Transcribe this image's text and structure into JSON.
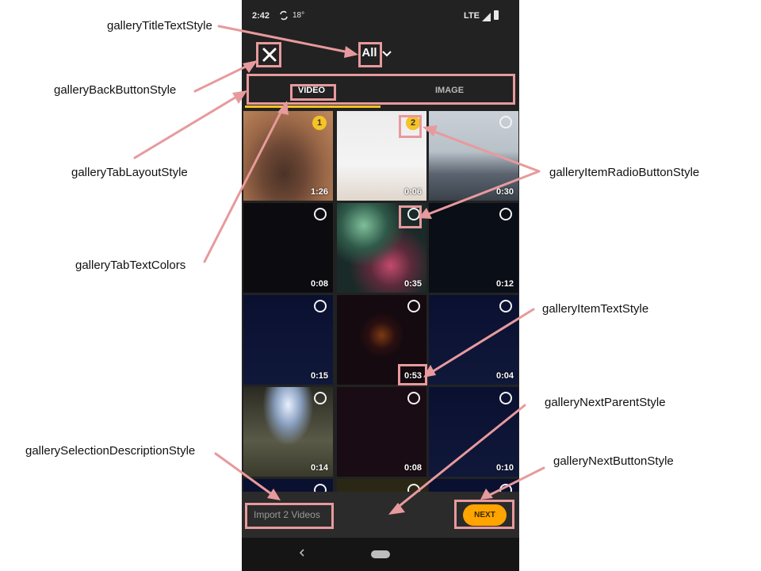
{
  "status_bar": {
    "time": "2:42",
    "temperature": "18°",
    "network": "LTE"
  },
  "header": {
    "title": "All",
    "back_icon": "close-icon",
    "dropdown_icon": "chevron-down-icon"
  },
  "tabs": [
    {
      "label": "VIDEO",
      "selected": true
    },
    {
      "label": "IMAGE",
      "selected": false
    }
  ],
  "gallery": {
    "items": [
      {
        "duration": "1:26",
        "selection": "1",
        "thumb": "desert-crater"
      },
      {
        "duration": "0:06",
        "selection": "2",
        "thumb": "toy-figure"
      },
      {
        "duration": "0:30",
        "selection": "",
        "thumb": "city-skyline"
      },
      {
        "duration": "0:08",
        "selection": "",
        "thumb": "dark"
      },
      {
        "duration": "0:35",
        "selection": "",
        "thumb": "fireworks"
      },
      {
        "duration": "0:12",
        "selection": "",
        "thumb": "night-sky"
      },
      {
        "duration": "0:15",
        "selection": "",
        "thumb": "night-blue"
      },
      {
        "duration": "0:53",
        "selection": "",
        "thumb": "night-sparks"
      },
      {
        "duration": "0:04",
        "selection": "",
        "thumb": "night-blue"
      },
      {
        "duration": "0:14",
        "selection": "",
        "thumb": "sparkler-ground"
      },
      {
        "duration": "0:08",
        "selection": "",
        "thumb": "dark-red"
      },
      {
        "duration": "0:10",
        "selection": "",
        "thumb": "night-blue"
      }
    ]
  },
  "footer": {
    "selection_description": "Import 2 Videos",
    "next_label": "NEXT"
  },
  "annotations": {
    "title_text_style": "galleryTitleTextStyle",
    "back_button_style": "galleryBackButtonStyle",
    "tab_layout_style": "galleryTabLayoutStyle",
    "tab_text_colors": "galleryTabTextColors",
    "item_radio_button_style": "galleryItemRadioButtonStyle",
    "item_text_style": "galleryItemTextStyle",
    "next_parent_style": "galleryNextParentStyle",
    "selection_description_style": "gallerySelectionDescriptionStyle",
    "next_button_style": "galleryNextButtonStyle"
  },
  "colors": {
    "accent": "#f6c324",
    "next_button": "#ffa400",
    "annotation_border": "#e79a9d",
    "background": "#222222"
  }
}
